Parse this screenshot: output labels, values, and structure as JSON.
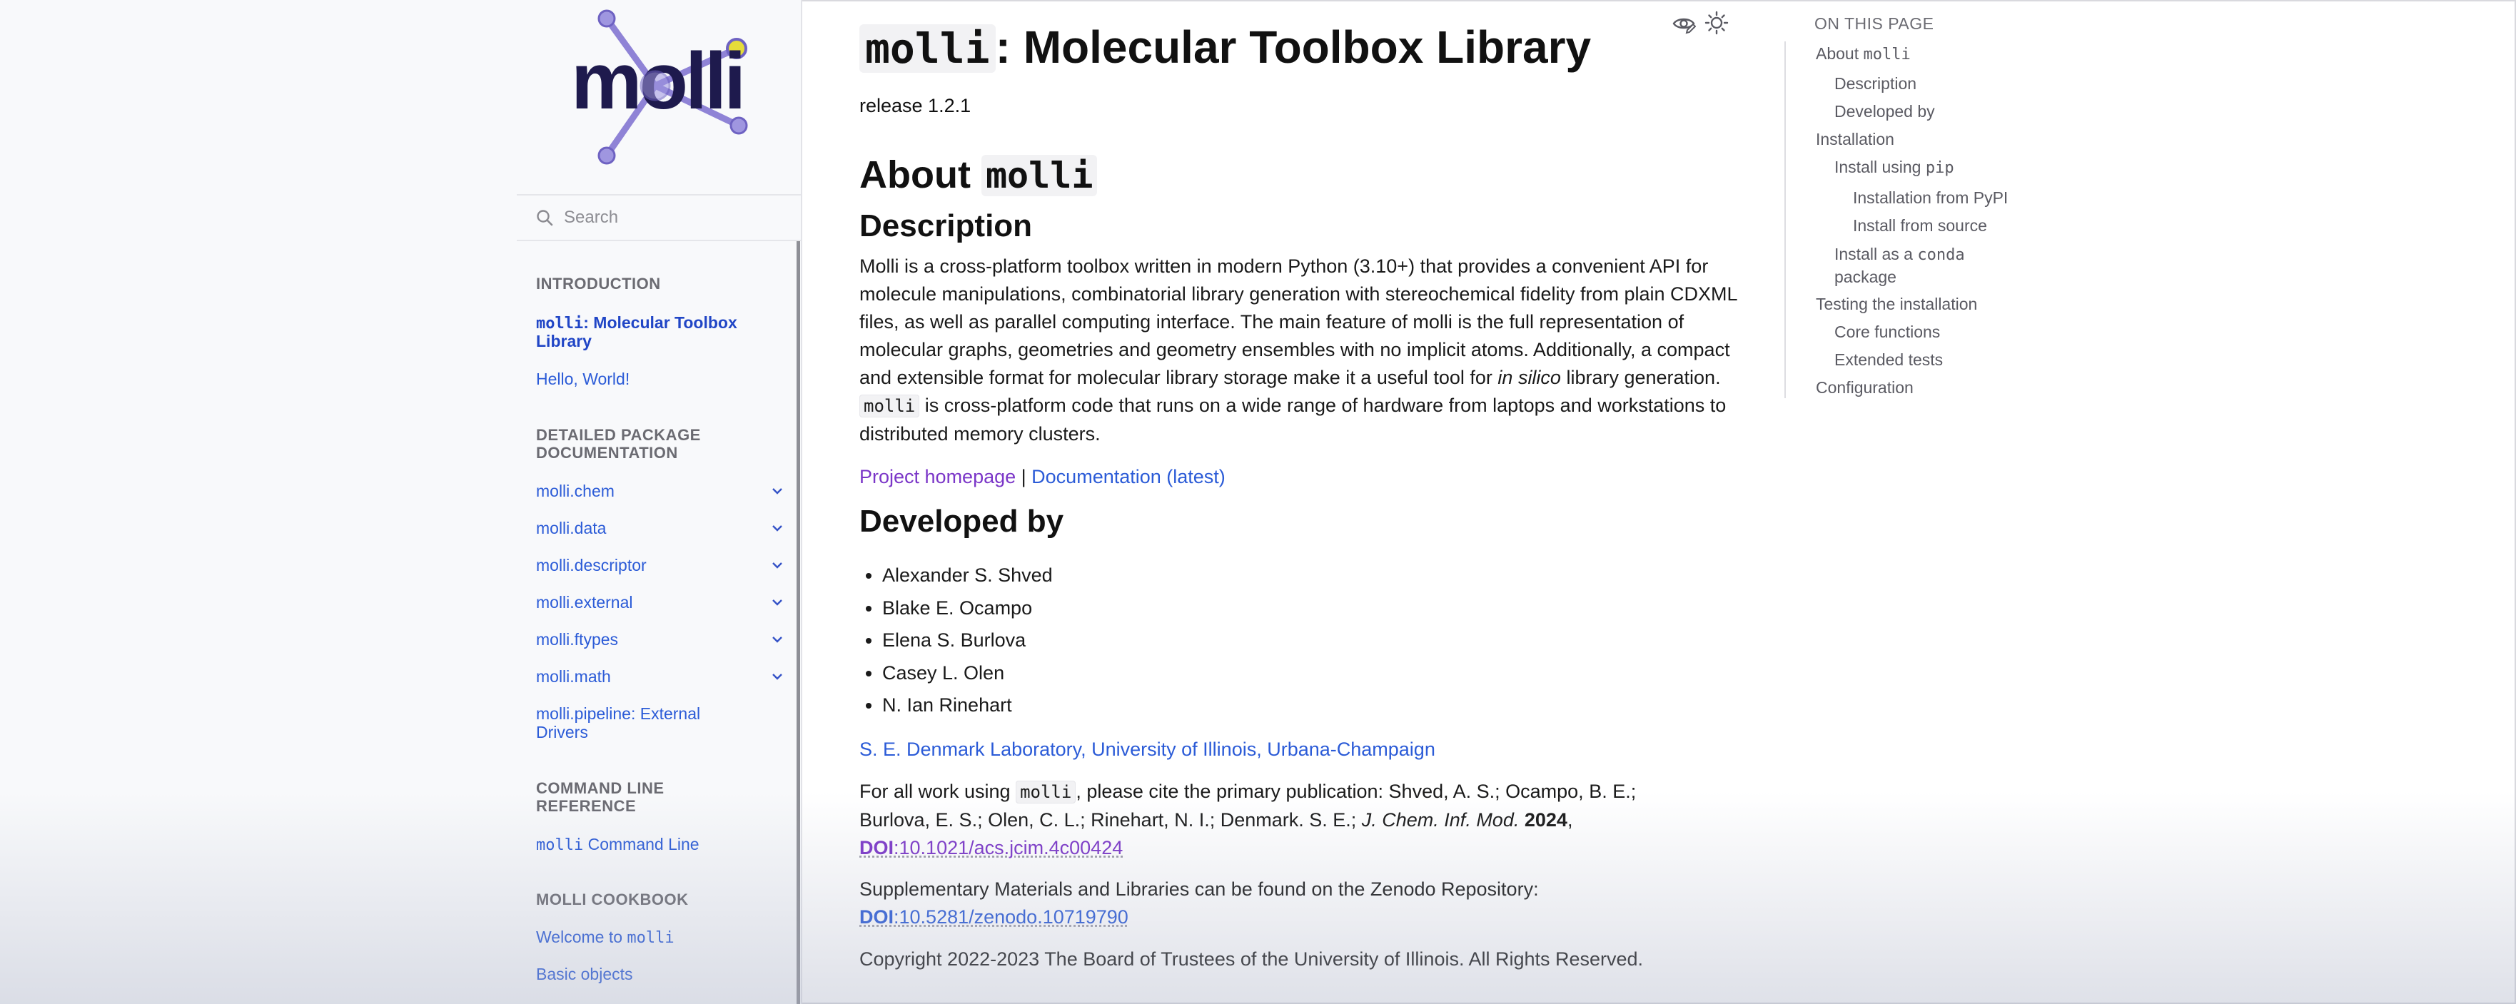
{
  "logo": {
    "text": "molli",
    "accent_color": "#8f83d6",
    "dot_color": "#e5dc3a"
  },
  "search": {
    "placeholder": "Search"
  },
  "sidebar": {
    "sections": [
      {
        "caption": "INTRODUCTION",
        "items": [
          {
            "code": "molli",
            "label": ": Molecular Toolbox Library",
            "current": true
          },
          {
            "label": "Hello, World!"
          }
        ]
      },
      {
        "caption": "DETAILED PACKAGE DOCUMENTATION",
        "items": [
          {
            "label": "molli.chem",
            "expandable": true
          },
          {
            "label": "molli.data",
            "expandable": true
          },
          {
            "label": "molli.descriptor",
            "expandable": true
          },
          {
            "label": "molli.external",
            "expandable": true
          },
          {
            "label": "molli.ftypes",
            "expandable": true
          },
          {
            "label": "molli.math",
            "expandable": true
          },
          {
            "label": "molli.pipeline: External Drivers"
          }
        ]
      },
      {
        "caption": "COMMAND LINE REFERENCE",
        "items": [
          {
            "code": "molli",
            "label": " Command Line"
          }
        ]
      },
      {
        "caption": "MOLLI COOKBOOK",
        "items": [
          {
            "label": "Welcome to ",
            "code": "molli"
          },
          {
            "label": "Basic objects"
          }
        ]
      }
    ]
  },
  "main": {
    "title_code": "molli",
    "title_rest": ": Molecular Toolbox Library",
    "release": "release 1.2.1",
    "about_heading": "About ",
    "about_code": "molli",
    "description_heading": "Description",
    "description": {
      "part1": "Molli is a cross-platform toolbox written in modern Python (3.10+) that provides a convenient API for molecule manipulations, combinatorial library generation with stereochemical fidelity from plain CDXML files, as well as parallel computing interface. The main feature of molli is the full representation of molecular graphs, geometries and geometry ensembles with no implicit atoms. Additionally, a compact and extensible format for molecular library storage make it a useful tool for ",
      "italic": "in silico",
      "part2": " library generation. ",
      "code": "molli",
      "part3": " is cross-platform code that runs on a wide range of hardware from laptops and workstations to distributed memory clusters."
    },
    "links": {
      "project": "Project homepage",
      "separator": " | ",
      "docs": "Documentation (latest)"
    },
    "developed_heading": "Developed by",
    "authors": [
      "Alexander S. Shved",
      "Blake E. Ocampo",
      "Elena S. Burlova",
      "Casey L. Olen",
      "N. Ian Rinehart"
    ],
    "lab": "S. E. Denmark Laboratory, University of Illinois, Urbana-Champaign",
    "cite": {
      "before": "For all work using ",
      "code": "molli",
      "after": ", please cite the primary publication: Shved, A. S.; Ocampo, B. E.; Burlova, E. S.; Olen, C. L.; Rinehart, N. I.; Denmark. S. E.; ",
      "journal": "J. Chem. Inf. Mod.",
      "year": "2024",
      "comma": ", ",
      "doi_label": "DOI",
      "doi": ":10.1021/acs.jcim.4c00424"
    },
    "supp": {
      "before": "Supplementary Materials and Libraries can be found on the Zenodo Repository: ",
      "doi_label": "DOI",
      "doi": ":10.5281/zenodo.10719790"
    },
    "copyright": "Copyright 2022-2023 The Board of Trustees of the University of Illinois. All Rights Reserved."
  },
  "toc": {
    "caption": "ON THIS PAGE",
    "items": [
      {
        "label": "About ",
        "code": "molli",
        "level": 0
      },
      {
        "label": "Description",
        "level": 1
      },
      {
        "label": "Developed by",
        "level": 1
      },
      {
        "label": "Installation",
        "level": 0
      },
      {
        "label": "Install using ",
        "code": "pip",
        "level": 1
      },
      {
        "label": "Installation from PyPI",
        "level": 2
      },
      {
        "label": "Install from source",
        "level": 2
      },
      {
        "label": "Install as a ",
        "code": "conda",
        "label2": "package",
        "level": 1
      },
      {
        "label": "Testing the installation",
        "level": 0
      },
      {
        "label": "Core functions",
        "level": 1
      },
      {
        "label": "Extended tests",
        "level": 1
      },
      {
        "label": "Configuration",
        "level": 0
      }
    ]
  },
  "icons": {
    "view_source": "eye-edit-icon",
    "theme": "sun-icon",
    "search": "search-icon",
    "chevron": "chevron-down-icon"
  }
}
